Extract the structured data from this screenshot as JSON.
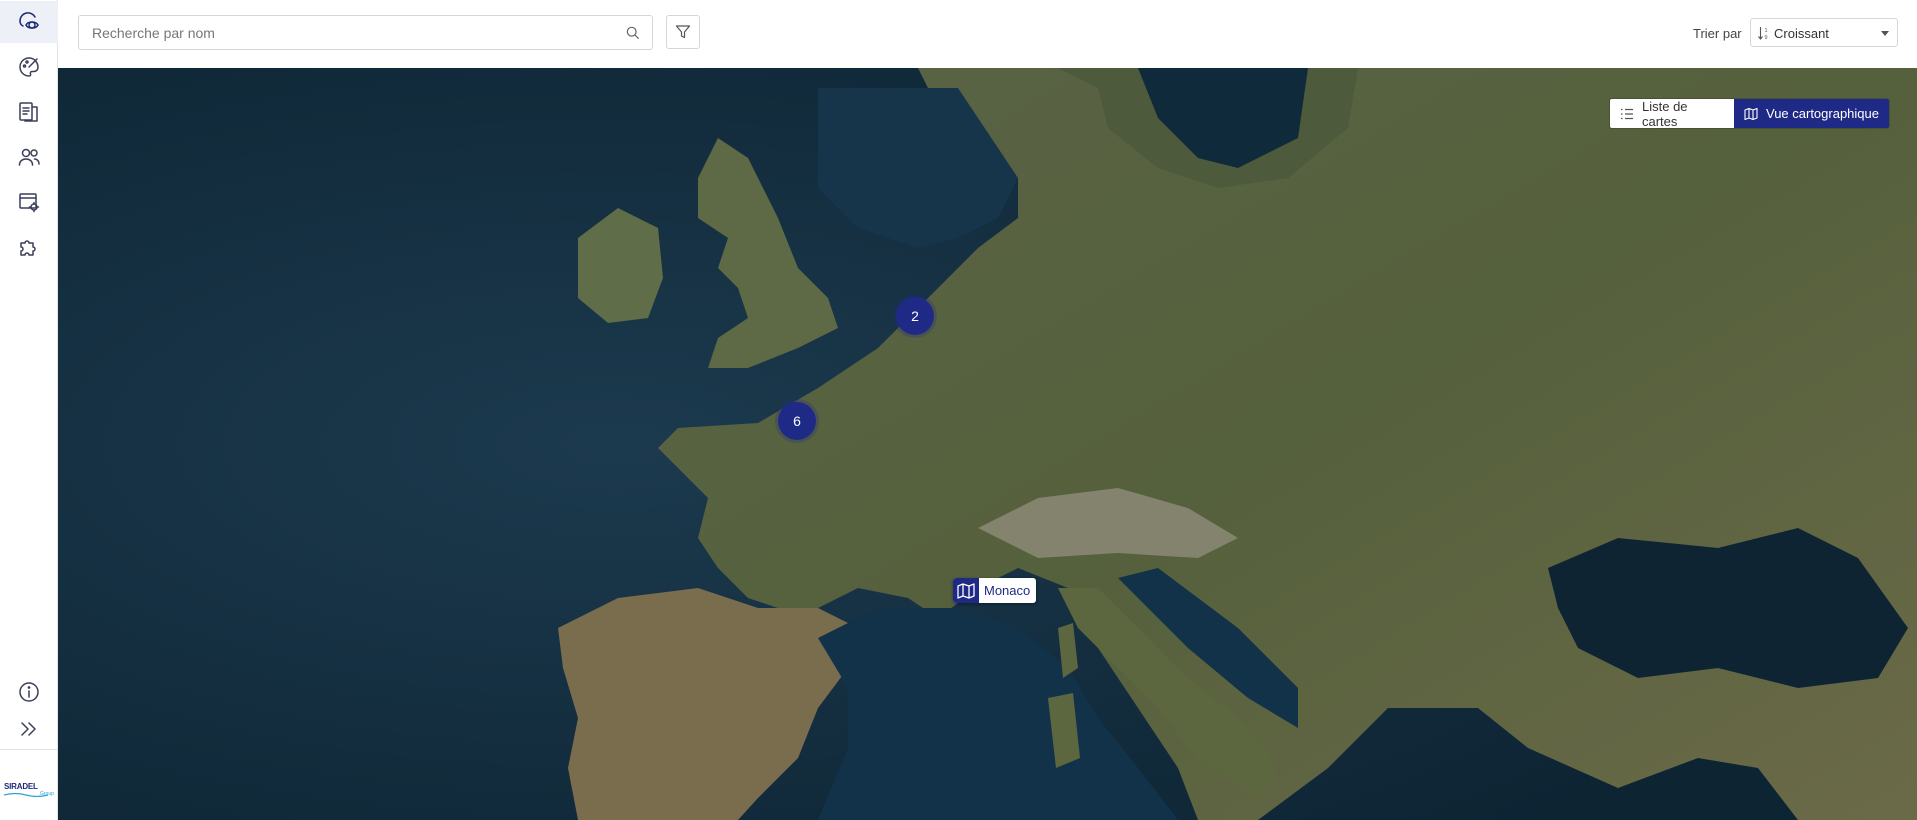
{
  "search": {
    "placeholder": "Recherche par nom",
    "value": ""
  },
  "sort": {
    "label": "Trier par",
    "value": "Croissant"
  },
  "view_toggle": {
    "list_label": "Liste de cartes",
    "map_label": "Vue cartographique",
    "active": "map"
  },
  "sidebar": {
    "items": [
      {
        "icon": "map-view-icon",
        "active": true
      },
      {
        "icon": "palette-icon",
        "active": false
      },
      {
        "icon": "documents-icon",
        "active": false
      },
      {
        "icon": "users-icon",
        "active": false
      },
      {
        "icon": "window-settings-icon",
        "active": false
      },
      {
        "icon": "puzzle-icon",
        "active": false
      }
    ],
    "bottom": [
      {
        "icon": "info-icon"
      },
      {
        "icon": "expand-icon"
      }
    ],
    "logo": {
      "text": "SIRADEL",
      "sub": "Group"
    }
  },
  "map": {
    "clusters": [
      {
        "count": "2"
      },
      {
        "count": "6"
      }
    ],
    "markers": [
      {
        "label": "Monaco",
        "icon": "map-icon"
      }
    ]
  },
  "colors": {
    "accent": "#1f2a86",
    "sea": "#0f2a3a",
    "land": "#4f5a3a"
  }
}
